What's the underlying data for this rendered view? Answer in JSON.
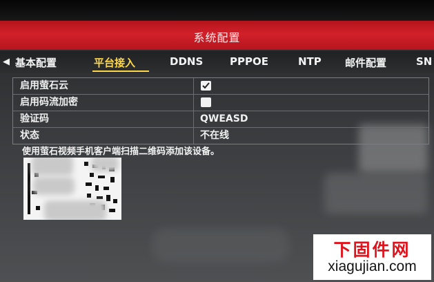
{
  "window": {
    "title": "系统配置"
  },
  "tabs": {
    "prev_arrow": "◀",
    "items": [
      {
        "label": "基本配置"
      },
      {
        "label": "平台接入",
        "active": true
      },
      {
        "label": "DDNS"
      },
      {
        "label": "PPPOE"
      },
      {
        "label": "NTP"
      },
      {
        "label": "邮件配置"
      },
      {
        "label": "SN"
      }
    ]
  },
  "settings": {
    "ezviz_cloud": {
      "label": "启用萤石云",
      "checked": true
    },
    "stream_encrypt": {
      "label": "启用码流加密",
      "checked": false
    },
    "verification_code": {
      "label": "验证码",
      "value": "QWEASD"
    },
    "status": {
      "label": "状态",
      "value": "不在线"
    }
  },
  "hint": "使用萤石视频手机客户端扫描二维码添加该设备。",
  "watermark": {
    "cn": "下固件网",
    "url": "xiagujian.com"
  },
  "colors": {
    "title_bar": "#d2202a",
    "active_tab": "#ffd84a",
    "watermark_red": "#e0121b"
  }
}
